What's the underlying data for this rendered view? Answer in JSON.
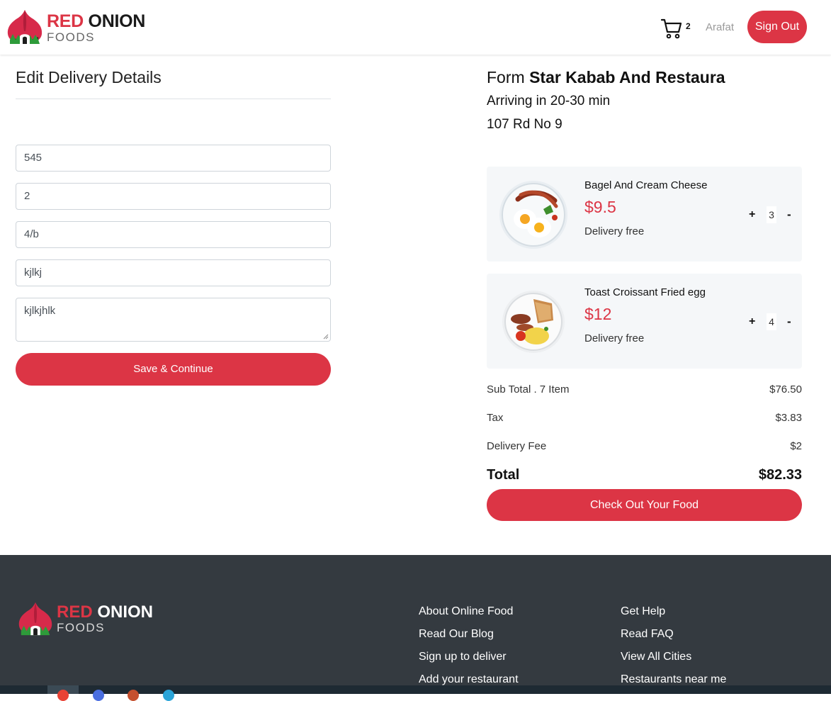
{
  "header": {
    "brand_red": "RED",
    "brand_dark": "ONION",
    "brand_sub": "FOODS",
    "cart_count": "2",
    "user_name": "Arafat",
    "signout_label": "Sign Out"
  },
  "delivery_form": {
    "title": "Edit Delivery Details",
    "fields": [
      {
        "value": "545"
      },
      {
        "value": "2"
      },
      {
        "value": "4/b"
      },
      {
        "value": "kjlkj"
      },
      {
        "value": "kjlkjhlk"
      }
    ],
    "save_label": "Save & Continue"
  },
  "order": {
    "from_prefix": "Form",
    "restaurant": "Star Kabab And Restaura",
    "arrival": "Arriving in 20-30 min",
    "address": "107 Rd No 9",
    "items": [
      {
        "name": "Bagel And Cream Cheese",
        "price": "$9.5",
        "delivery": "Delivery free",
        "qty": "3",
        "plus": "+",
        "minus": "-"
      },
      {
        "name": "Toast Croissant Fried egg",
        "price": "$12",
        "delivery": "Delivery free",
        "qty": "4",
        "plus": "+",
        "minus": "-"
      }
    ],
    "summary": {
      "subtotal_label": "Sub Total . 7 Item",
      "subtotal_value": "$76.50",
      "tax_label": "Tax",
      "tax_value": "$3.83",
      "delivery_label": "Delivery Fee",
      "delivery_value": "$2",
      "total_label": "Total",
      "total_value": "$82.33"
    },
    "checkout_label": "Check Out Your Food"
  },
  "footer": {
    "brand_red": "RED",
    "brand_light": "ONION",
    "brand_sub": "FOODS",
    "col1": [
      "About Online Food",
      "Read Our Blog",
      "Sign up to deliver",
      "Add your restaurant"
    ],
    "col2": [
      "Get Help",
      "Read FAQ",
      "View All Cities",
      "Restaurants near me"
    ]
  },
  "colors": {
    "accent": "#dc3545",
    "footer_bg": "#343a40",
    "card_bg": "#f5f7f9"
  }
}
